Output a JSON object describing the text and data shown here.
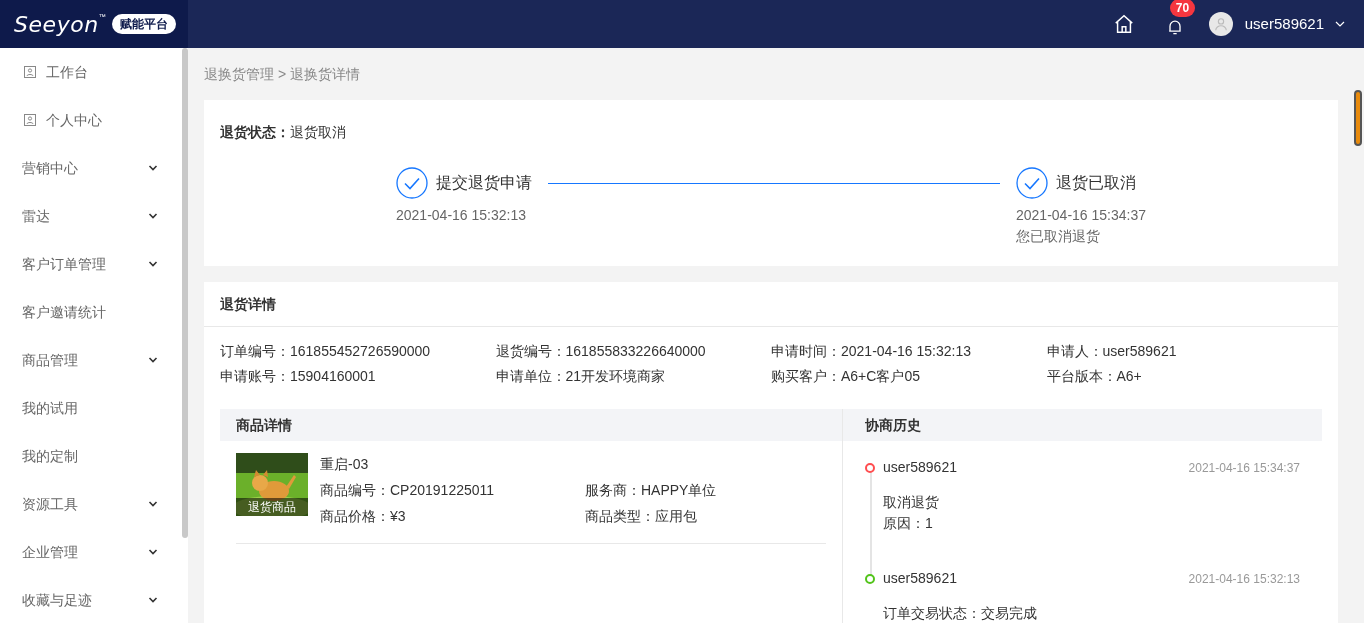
{
  "header": {
    "logo": "Seeyon",
    "logo_mark": "™",
    "platform_badge": "赋能平台",
    "notification_count": "70",
    "user_name": "user589621"
  },
  "sidebar": {
    "items": [
      {
        "label": "工作台",
        "kind": "icon",
        "expandable": false
      },
      {
        "label": "个人中心",
        "kind": "icon",
        "expandable": false
      },
      {
        "label": "营销中心",
        "kind": "plain",
        "expandable": true
      },
      {
        "label": "雷达",
        "kind": "plain",
        "expandable": true
      },
      {
        "label": "客户订单管理",
        "kind": "plain",
        "expandable": true
      },
      {
        "label": "客户邀请统计",
        "kind": "plain",
        "expandable": false
      },
      {
        "label": "商品管理",
        "kind": "plain",
        "expandable": true
      },
      {
        "label": "我的试用",
        "kind": "plain",
        "expandable": false
      },
      {
        "label": "我的定制",
        "kind": "plain",
        "expandable": false
      },
      {
        "label": "资源工具",
        "kind": "plain",
        "expandable": true
      },
      {
        "label": "企业管理",
        "kind": "plain",
        "expandable": true
      },
      {
        "label": "收藏与足迹",
        "kind": "plain",
        "expandable": true
      }
    ]
  },
  "breadcrumb": [
    "退换货管理",
    "退换货详情"
  ],
  "breadcrumb_separator": ">",
  "status": {
    "label": "退货状态：",
    "value": "退货取消"
  },
  "steps": [
    {
      "title": "提交退货申请",
      "time": "2021-04-16 15:32:13"
    },
    {
      "title": "退货已取消",
      "time": "2021-04-16 15:34:37",
      "note": "您已取消退货"
    }
  ],
  "details": {
    "title": "退货详情",
    "fields": [
      {
        "label": "订单编号：",
        "value": "161855452726590000"
      },
      {
        "label": "退货编号：",
        "value": "161855833226640000"
      },
      {
        "label": "申请时间：",
        "value": "2021-04-16 15:32:13"
      },
      {
        "label": "申请人：",
        "value": "user589621"
      },
      {
        "label": "申请账号：",
        "value": "15904160001"
      },
      {
        "label": "申请单位：",
        "value": "21开发环境商家"
      },
      {
        "label": "购买客户：",
        "value": "A6+C客户05"
      },
      {
        "label": "平台版本：",
        "value": "A6+"
      }
    ]
  },
  "product": {
    "title": "商品详情",
    "image_label": "退货商品",
    "name": "重启-03",
    "fields": [
      {
        "label": "商品编号：",
        "value": "CP20191225011"
      },
      {
        "label": "服务商：",
        "value": "HAPPY单位"
      },
      {
        "label": "商品价格：",
        "value": "¥3"
      },
      {
        "label": "商品类型：",
        "value": "应用包"
      }
    ]
  },
  "history": {
    "title": "协商历史",
    "entries": [
      {
        "user": "user589621",
        "time": "2021-04-16 15:34:37",
        "color": "#ff4d4f",
        "lines": [
          "取消退货",
          "原因：1"
        ]
      },
      {
        "user": "user589621",
        "time": "2021-04-16 15:32:13",
        "color": "#52c41a",
        "lines": [
          "订单交易状态：交易完成"
        ]
      }
    ]
  }
}
